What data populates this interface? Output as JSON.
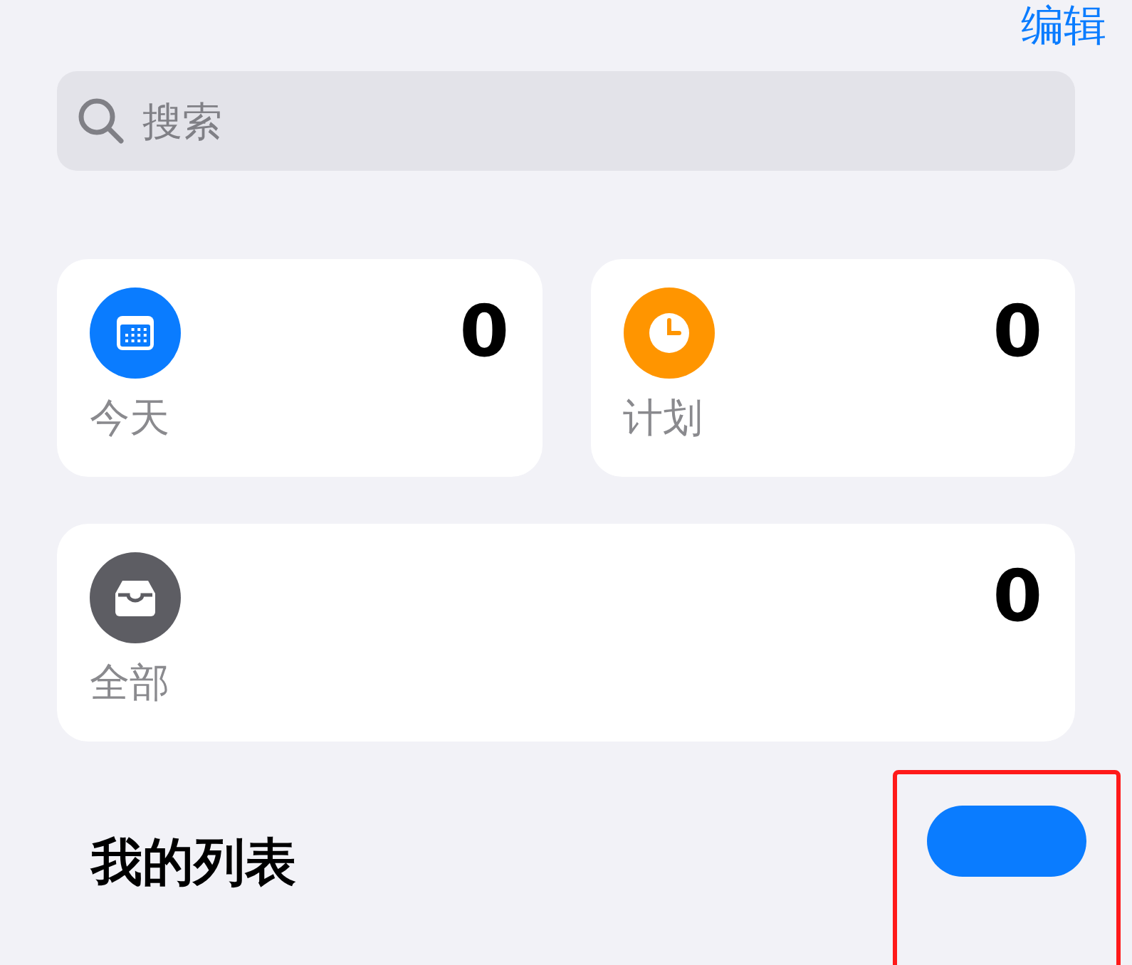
{
  "nav": {
    "edit": "编辑"
  },
  "search": {
    "placeholder": "搜索"
  },
  "smart_lists": [
    {
      "kind": "today",
      "label": "今天",
      "count": "0",
      "color": "#0a7cff"
    },
    {
      "kind": "scheduled",
      "label": "计划",
      "count": "0",
      "color": "#ff9500"
    },
    {
      "kind": "all",
      "label": "全部",
      "count": "0",
      "color": "#5d5d63"
    }
  ],
  "my_lists": {
    "title": "我的列表"
  }
}
